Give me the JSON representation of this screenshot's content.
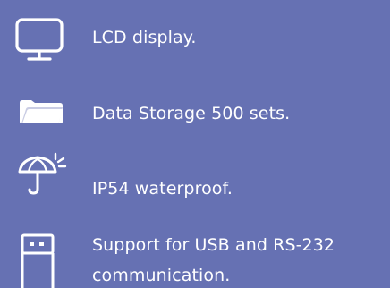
{
  "features": [
    {
      "icon": "monitor-icon",
      "text": "LCD display."
    },
    {
      "icon": "folder-icon",
      "text": "Data Storage 500 sets."
    },
    {
      "icon": "umbrella-icon",
      "text": "IP54 waterproof."
    },
    {
      "icon": "usb-drive-icon",
      "text": "Support for USB and RS-232 communication."
    }
  ],
  "colors": {
    "background": "#6671b3",
    "foreground": "#ffffff"
  }
}
